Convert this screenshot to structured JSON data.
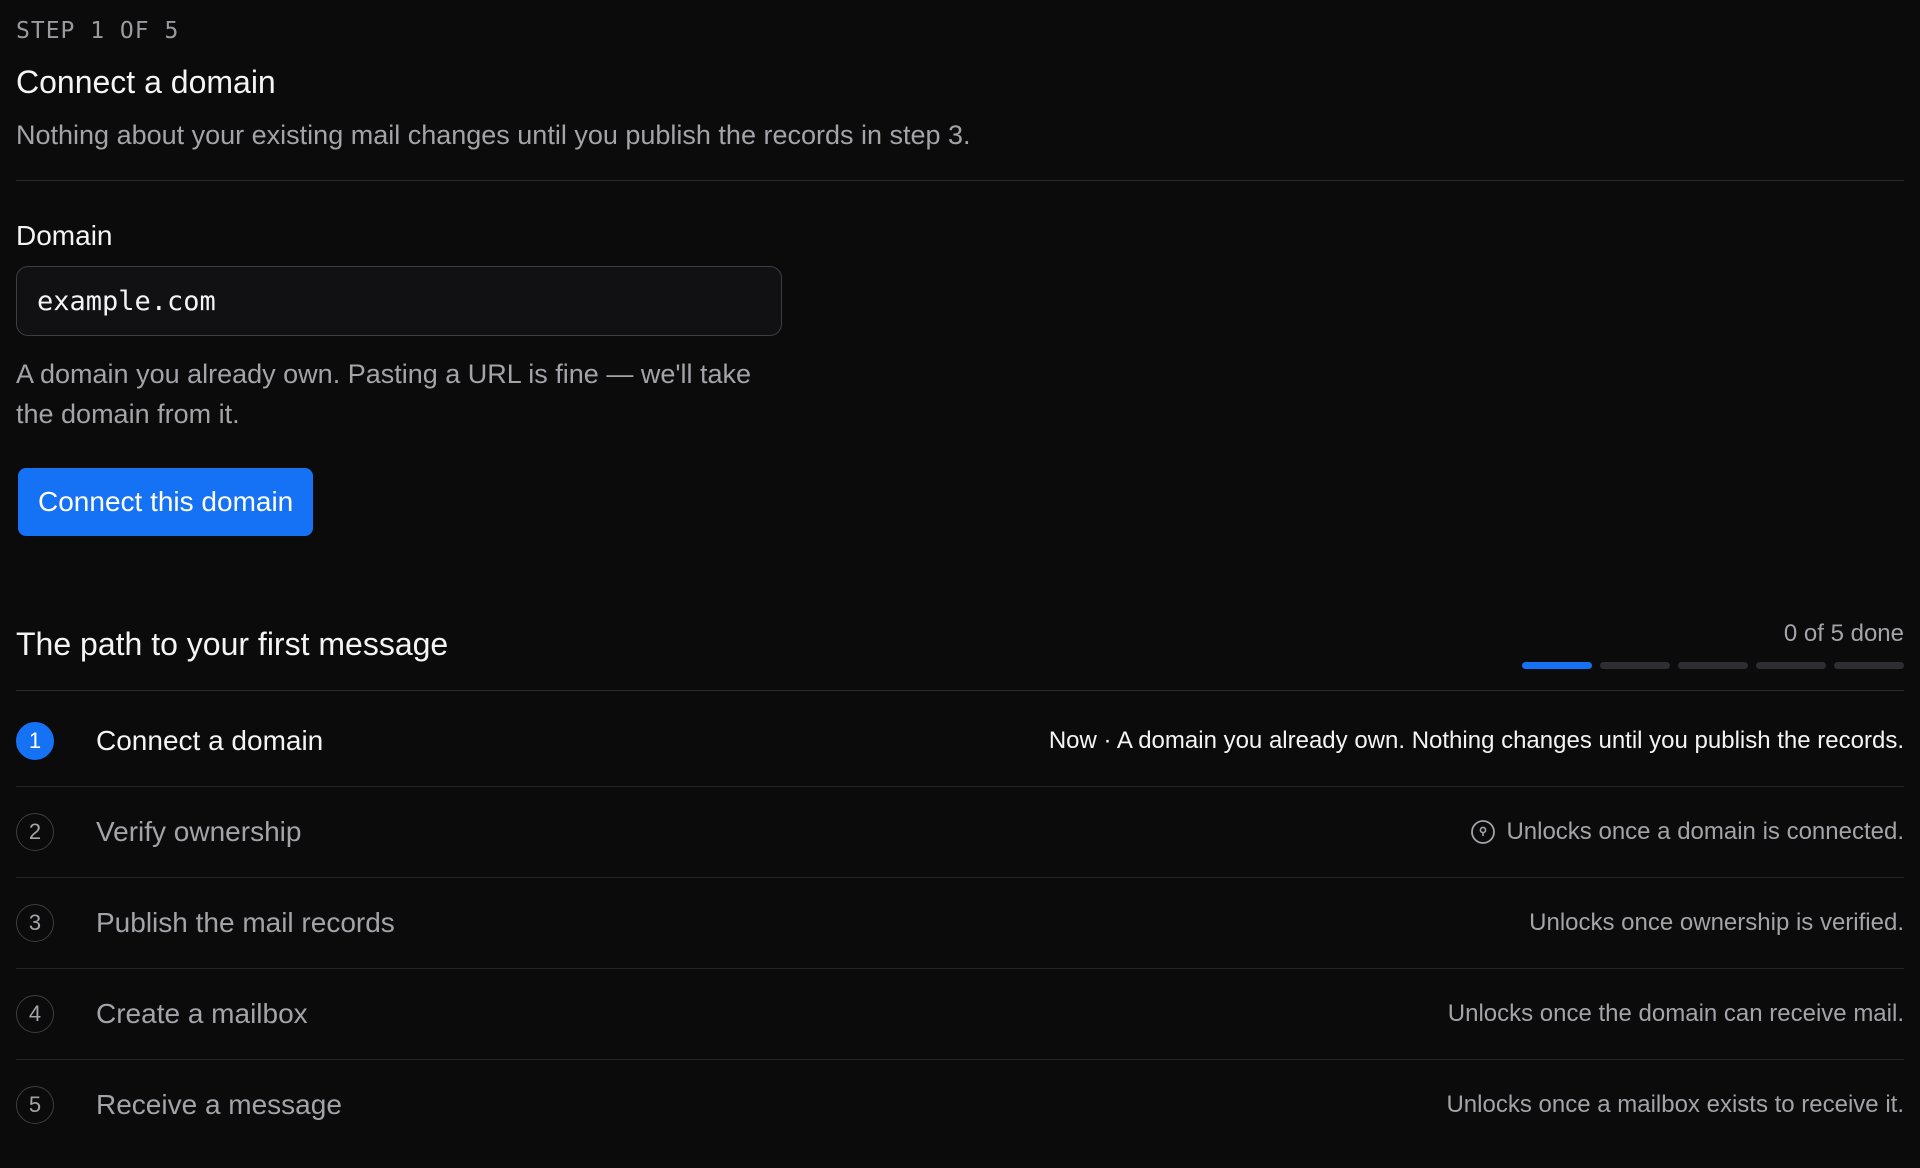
{
  "header": {
    "eyebrow": "STEP 1 OF 5",
    "title": "Connect a domain",
    "subtitle": "Nothing about your existing mail changes until you publish the records in step 3."
  },
  "form": {
    "label": "Domain",
    "input_placeholder": "example.com",
    "input_value": "",
    "help": "A domain you already own. Pasting a URL is fine — we'll take the domain from it.",
    "submit_label": "Connect this domain"
  },
  "path": {
    "title": "The path to your first message",
    "progress_text": "0 of 5 done",
    "progress_done": 0,
    "progress_total": 5,
    "progress_segments": [
      {
        "state": "active"
      },
      {
        "state": "pending"
      },
      {
        "state": "pending"
      },
      {
        "state": "pending"
      },
      {
        "state": "pending"
      }
    ],
    "steps": [
      {
        "number": "1",
        "name": "Connect a domain",
        "note": "Now · A domain you already own. Nothing changes until you publish the records.",
        "state": "current",
        "icon": ""
      },
      {
        "number": "2",
        "name": "Verify ownership",
        "note": "Unlocks once a domain is connected.",
        "state": "locked",
        "icon": "lock-icon"
      },
      {
        "number": "3",
        "name": "Publish the mail records",
        "note": "Unlocks once ownership is verified.",
        "state": "locked",
        "icon": ""
      },
      {
        "number": "4",
        "name": "Create a mailbox",
        "note": "Unlocks once the domain can receive mail.",
        "state": "locked",
        "icon": ""
      },
      {
        "number": "5",
        "name": "Receive a message",
        "note": "Unlocks once a mailbox exists to receive it.",
        "state": "locked",
        "icon": ""
      }
    ]
  },
  "colors": {
    "accent": "#1672f5",
    "background": "#0b0b0c",
    "muted_text": "#a3a3a8"
  }
}
